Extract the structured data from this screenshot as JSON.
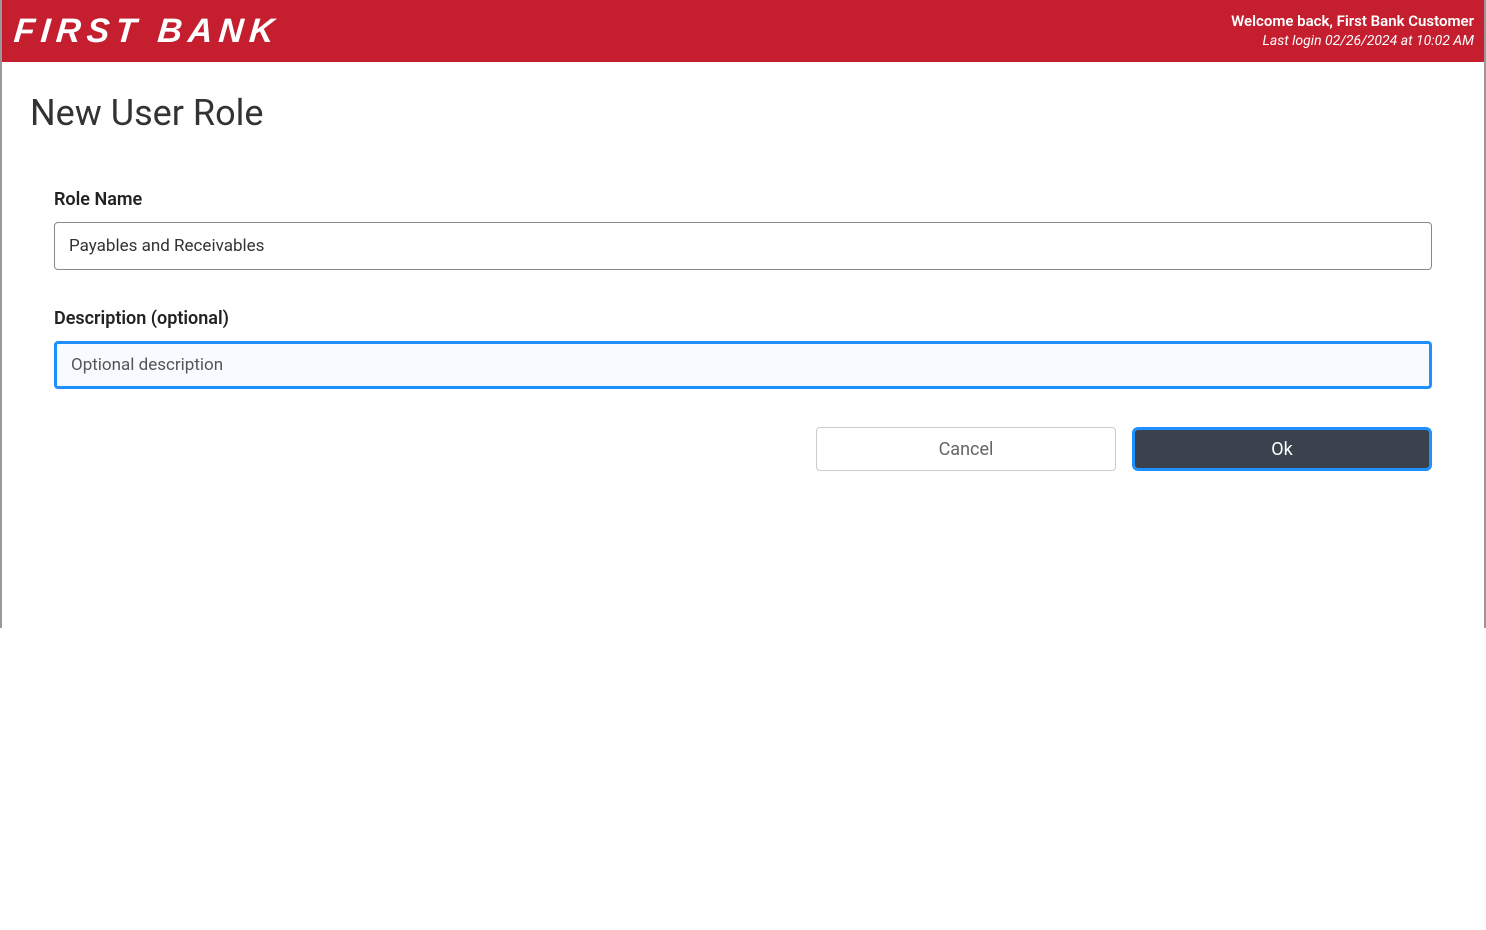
{
  "header": {
    "logo_text": "FIRST BANK",
    "welcome_text": "Welcome back, First Bank Customer",
    "last_login_text": "Last login 02/26/2024 at 10:02 AM"
  },
  "page": {
    "title": "New User Role"
  },
  "form": {
    "role_name": {
      "label": "Role Name",
      "value": "Payables and Receivables"
    },
    "description": {
      "label": "Description (optional)",
      "placeholder": "Optional description",
      "value": ""
    }
  },
  "buttons": {
    "cancel_label": "Cancel",
    "ok_label": "Ok"
  }
}
